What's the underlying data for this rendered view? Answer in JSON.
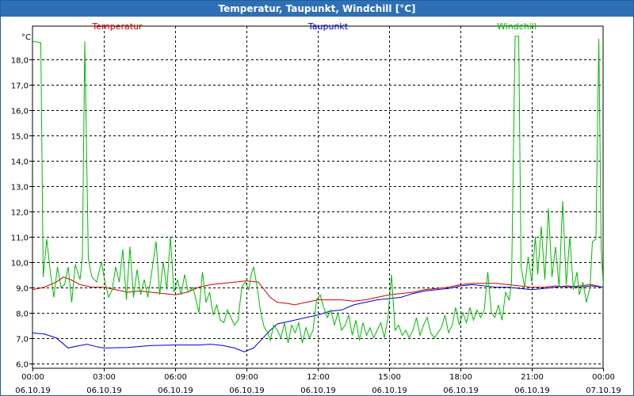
{
  "window": {
    "title": "Temperatur, Taupunkt, Windchill [°C]"
  },
  "chart_data": {
    "type": "line",
    "title": "Temperatur, Taupunkt, Windchill [°C]",
    "ylabel": "°C",
    "xlabel": "",
    "ylim": [
      5.8,
      19.3
    ],
    "xlim": [
      0,
      24
    ],
    "grid": true,
    "legend_placement": "top",
    "y_ticks": [
      {
        "value": 18.0,
        "label": "18,0"
      },
      {
        "value": 17.0,
        "label": "17,0"
      },
      {
        "value": 16.0,
        "label": "16,0"
      },
      {
        "value": 15.0,
        "label": "15,0"
      },
      {
        "value": 14.0,
        "label": "14,0"
      },
      {
        "value": 13.0,
        "label": "13,0"
      },
      {
        "value": 12.0,
        "label": "12,0"
      },
      {
        "value": 11.0,
        "label": "11,0"
      },
      {
        "value": 10.0,
        "label": "10,0"
      },
      {
        "value": 9.0,
        "label": "9,0"
      },
      {
        "value": 8.0,
        "label": "8,0"
      },
      {
        "value": 7.0,
        "label": "7,0"
      },
      {
        "value": 6.0,
        "label": "6,0"
      }
    ],
    "x_ticks": [
      {
        "value": 0,
        "time": "00:00",
        "date": "06.10.19"
      },
      {
        "value": 3,
        "time": "03:00",
        "date": "06.10.19"
      },
      {
        "value": 6,
        "time": "06:00",
        "date": "06.10.19"
      },
      {
        "value": 9,
        "time": "09:00",
        "date": "06.10.19"
      },
      {
        "value": 12,
        "time": "12:00",
        "date": "06.10.19"
      },
      {
        "value": 15,
        "time": "15:00",
        "date": "06.10.19"
      },
      {
        "value": 18,
        "time": "18:00",
        "date": "06.10.19"
      },
      {
        "value": 21,
        "time": "21:00",
        "date": "06.10.19"
      },
      {
        "value": 24,
        "time": "00:00",
        "date": "07.10.19"
      }
    ],
    "series": [
      {
        "name": "Temperatur",
        "color": "#cc0000",
        "points": [
          [
            0,
            8.9
          ],
          [
            0.5,
            9.0
          ],
          [
            1,
            9.2
          ],
          [
            1.3,
            9.4
          ],
          [
            1.6,
            9.3
          ],
          [
            2,
            9.1
          ],
          [
            2.5,
            9.0
          ],
          [
            3,
            9.0
          ],
          [
            3.5,
            8.9
          ],
          [
            4,
            8.8
          ],
          [
            4.5,
            8.85
          ],
          [
            5,
            8.8
          ],
          [
            5.5,
            8.75
          ],
          [
            6,
            8.7
          ],
          [
            6.5,
            8.8
          ],
          [
            7,
            9.0
          ],
          [
            7.5,
            9.1
          ],
          [
            8,
            9.15
          ],
          [
            8.5,
            9.2
          ],
          [
            9,
            9.25
          ],
          [
            9.5,
            9.2
          ],
          [
            10,
            8.6
          ],
          [
            10.3,
            8.4
          ],
          [
            10.8,
            8.35
          ],
          [
            11,
            8.3
          ],
          [
            11.5,
            8.4
          ],
          [
            12,
            8.5
          ],
          [
            12.5,
            8.5
          ],
          [
            13,
            8.5
          ],
          [
            13.5,
            8.45
          ],
          [
            14,
            8.5
          ],
          [
            14.5,
            8.6
          ],
          [
            15,
            8.7
          ],
          [
            15.5,
            8.75
          ],
          [
            16,
            8.8
          ],
          [
            16.5,
            8.9
          ],
          [
            17,
            8.95
          ],
          [
            17.5,
            9.0
          ],
          [
            18,
            9.1
          ],
          [
            18.5,
            9.15
          ],
          [
            19,
            9.15
          ],
          [
            19.5,
            9.15
          ],
          [
            20,
            9.1
          ],
          [
            20.5,
            9.05
          ],
          [
            21,
            9.0
          ],
          [
            21.5,
            9.0
          ],
          [
            22,
            9.05
          ],
          [
            22.5,
            9.0
          ],
          [
            23,
            9.05
          ],
          [
            23.5,
            9.1
          ],
          [
            24,
            9.0
          ]
        ]
      },
      {
        "name": "Taupunkt",
        "color": "#0000cc",
        "points": [
          [
            0,
            7.2
          ],
          [
            0.5,
            7.15
          ],
          [
            1,
            7.0
          ],
          [
            1.5,
            6.6
          ],
          [
            2,
            6.7
          ],
          [
            2.3,
            6.75
          ],
          [
            2.7,
            6.65
          ],
          [
            3,
            6.6
          ],
          [
            4,
            6.62
          ],
          [
            5,
            6.7
          ],
          [
            6,
            6.72
          ],
          [
            7,
            6.72
          ],
          [
            7.5,
            6.75
          ],
          [
            8,
            6.7
          ],
          [
            8.5,
            6.6
          ],
          [
            8.9,
            6.45
          ],
          [
            9.3,
            6.6
          ],
          [
            9.6,
            6.9
          ],
          [
            10,
            7.3
          ],
          [
            10.3,
            7.55
          ],
          [
            10.8,
            7.65
          ],
          [
            11.5,
            7.8
          ],
          [
            12,
            7.9
          ],
          [
            12.5,
            8.05
          ],
          [
            13,
            8.1
          ],
          [
            13.5,
            8.3
          ],
          [
            14,
            8.4
          ],
          [
            14.5,
            8.5
          ],
          [
            15,
            8.55
          ],
          [
            15.5,
            8.6
          ],
          [
            16,
            8.75
          ],
          [
            16.5,
            8.85
          ],
          [
            17,
            8.9
          ],
          [
            17.5,
            8.95
          ],
          [
            18,
            9.05
          ],
          [
            18.5,
            9.1
          ],
          [
            19,
            9.05
          ],
          [
            19.5,
            9.0
          ],
          [
            20,
            9.0
          ],
          [
            20.5,
            8.95
          ],
          [
            21,
            8.9
          ],
          [
            21.5,
            8.95
          ],
          [
            22,
            9.0
          ],
          [
            22.5,
            9.05
          ],
          [
            23,
            9.0
          ],
          [
            23.5,
            9.05
          ],
          [
            24,
            9.0
          ]
        ]
      },
      {
        "name": "Windchill",
        "color": "#00bb00",
        "points": [
          [
            0,
            18.7
          ],
          [
            0.35,
            18.65
          ],
          [
            0.45,
            9.4
          ],
          [
            0.6,
            10.9
          ],
          [
            0.75,
            9.6
          ],
          [
            0.9,
            8.6
          ],
          [
            1.05,
            9.8
          ],
          [
            1.2,
            9.0
          ],
          [
            1.35,
            9.1
          ],
          [
            1.5,
            9.8
          ],
          [
            1.65,
            8.4
          ],
          [
            1.8,
            9.9
          ],
          [
            2.0,
            9.3
          ],
          [
            2.1,
            10.2
          ],
          [
            2.2,
            18.7
          ],
          [
            2.35,
            10.1
          ],
          [
            2.5,
            9.4
          ],
          [
            2.7,
            9.2
          ],
          [
            2.9,
            10.0
          ],
          [
            3.05,
            9.2
          ],
          [
            3.2,
            8.6
          ],
          [
            3.35,
            8.9
          ],
          [
            3.5,
            9.8
          ],
          [
            3.65,
            9.2
          ],
          [
            3.8,
            10.5
          ],
          [
            3.95,
            8.5
          ],
          [
            4.1,
            10.6
          ],
          [
            4.25,
            8.6
          ],
          [
            4.4,
            9.7
          ],
          [
            4.55,
            8.7
          ],
          [
            4.7,
            9.3
          ],
          [
            4.85,
            8.6
          ],
          [
            5.0,
            9.5
          ],
          [
            5.2,
            10.8
          ],
          [
            5.35,
            8.7
          ],
          [
            5.5,
            10.0
          ],
          [
            5.65,
            8.9
          ],
          [
            5.8,
            11.0
          ],
          [
            5.95,
            8.8
          ],
          [
            6.1,
            9.3
          ],
          [
            6.25,
            8.7
          ],
          [
            6.4,
            9.5
          ],
          [
            6.55,
            8.8
          ],
          [
            6.75,
            9.0
          ],
          [
            7.0,
            8.0
          ],
          [
            7.15,
            9.6
          ],
          [
            7.3,
            8.4
          ],
          [
            7.45,
            8.8
          ],
          [
            7.6,
            7.9
          ],
          [
            7.75,
            8.3
          ],
          [
            7.9,
            7.7
          ],
          [
            8.05,
            7.6
          ],
          [
            8.2,
            8.1
          ],
          [
            8.35,
            7.8
          ],
          [
            8.5,
            7.5
          ],
          [
            8.65,
            7.7
          ],
          [
            8.8,
            9.0
          ],
          [
            8.95,
            9.2
          ],
          [
            9.1,
            8.9
          ],
          [
            9.2,
            9.5
          ],
          [
            9.3,
            9.8
          ],
          [
            9.45,
            9.0
          ],
          [
            9.6,
            8.0
          ],
          [
            9.75,
            7.4
          ],
          [
            9.9,
            7.2
          ],
          [
            10.0,
            6.9
          ],
          [
            10.15,
            7.5
          ],
          [
            10.3,
            7.3
          ],
          [
            10.45,
            7.0
          ],
          [
            10.6,
            7.6
          ],
          [
            10.75,
            6.8
          ],
          [
            10.9,
            7.5
          ],
          [
            11.05,
            7.2
          ],
          [
            11.2,
            7.6
          ],
          [
            11.35,
            6.8
          ],
          [
            11.5,
            7.4
          ],
          [
            11.65,
            7.0
          ],
          [
            11.8,
            7.3
          ],
          [
            11.95,
            8.5
          ],
          [
            12.1,
            8.7
          ],
          [
            12.25,
            8.2
          ],
          [
            12.4,
            7.8
          ],
          [
            12.55,
            8.1
          ],
          [
            12.7,
            7.5
          ],
          [
            12.85,
            8.0
          ],
          [
            13.0,
            7.3
          ],
          [
            13.15,
            7.5
          ],
          [
            13.3,
            7.9
          ],
          [
            13.45,
            7.1
          ],
          [
            13.6,
            7.7
          ],
          [
            13.75,
            6.9
          ],
          [
            13.9,
            7.6
          ],
          [
            14.05,
            7.1
          ],
          [
            14.2,
            7.4
          ],
          [
            14.35,
            7.0
          ],
          [
            14.5,
            7.3
          ],
          [
            14.65,
            7.6
          ],
          [
            14.8,
            7.0
          ],
          [
            14.95,
            7.8
          ],
          [
            15.1,
            9.5
          ],
          [
            15.25,
            7.3
          ],
          [
            15.4,
            7.5
          ],
          [
            15.55,
            7.1
          ],
          [
            15.7,
            7.3
          ],
          [
            15.85,
            7.0
          ],
          [
            16.0,
            7.3
          ],
          [
            16.15,
            7.8
          ],
          [
            16.3,
            7.1
          ],
          [
            16.45,
            7.5
          ],
          [
            16.6,
            7.8
          ],
          [
            16.75,
            7.2
          ],
          [
            16.9,
            7.0
          ],
          [
            17.05,
            7.2
          ],
          [
            17.2,
            7.4
          ],
          [
            17.35,
            7.9
          ],
          [
            17.5,
            7.2
          ],
          [
            17.65,
            7.5
          ],
          [
            17.8,
            8.2
          ],
          [
            17.95,
            7.5
          ],
          [
            18.1,
            8.0
          ],
          [
            18.25,
            7.6
          ],
          [
            18.4,
            8.2
          ],
          [
            18.55,
            7.7
          ],
          [
            18.7,
            8.1
          ],
          [
            18.85,
            7.8
          ],
          [
            19.0,
            8.1
          ],
          [
            19.15,
            9.6
          ],
          [
            19.3,
            8.0
          ],
          [
            19.45,
            7.8
          ],
          [
            19.6,
            8.3
          ],
          [
            19.75,
            7.7
          ],
          [
            19.9,
            8.8
          ],
          [
            20.05,
            8.5
          ],
          [
            20.15,
            9.2
          ],
          [
            20.3,
            18.9
          ],
          [
            20.45,
            18.9
          ],
          [
            20.55,
            9.8
          ],
          [
            20.7,
            9.0
          ],
          [
            20.85,
            10.2
          ],
          [
            21.0,
            9.2
          ],
          [
            21.15,
            11.0
          ],
          [
            21.25,
            9.5
          ],
          [
            21.4,
            11.4
          ],
          [
            21.55,
            9.3
          ],
          [
            21.7,
            12.1
          ],
          [
            21.85,
            9.4
          ],
          [
            22.0,
            10.6
          ],
          [
            22.15,
            9.0
          ],
          [
            22.3,
            12.4
          ],
          [
            22.45,
            9.1
          ],
          [
            22.6,
            11.0
          ],
          [
            22.75,
            8.9
          ],
          [
            22.9,
            9.6
          ],
          [
            23.0,
            8.7
          ],
          [
            23.15,
            9.2
          ],
          [
            23.3,
            8.4
          ],
          [
            23.45,
            9.0
          ],
          [
            23.55,
            10.8
          ],
          [
            23.7,
            10.9
          ],
          [
            23.82,
            18.8
          ],
          [
            23.92,
            10.5
          ],
          [
            24.05,
            8.4
          ],
          [
            24.2,
            18.7
          ]
        ]
      }
    ]
  }
}
